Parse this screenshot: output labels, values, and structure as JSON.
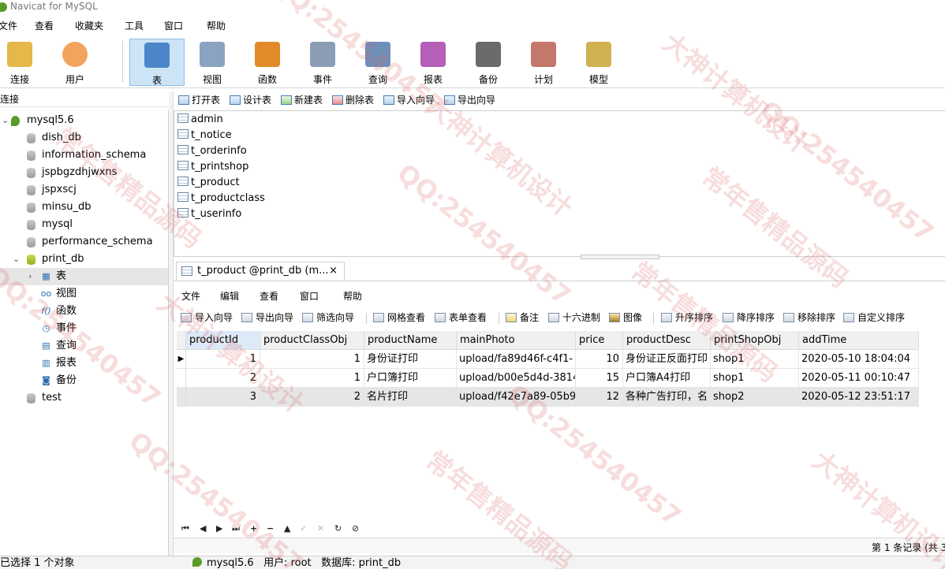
{
  "window": {
    "title": "Navicat for MySQL"
  },
  "menu": [
    "文件",
    "查看",
    "收藏夹",
    "工具",
    "窗口",
    "帮助"
  ],
  "toolbar": {
    "left": [
      {
        "name": "connect",
        "label": "连接",
        "icon": "connect-icon",
        "color": "#e6b84a"
      },
      {
        "name": "user",
        "label": "用户",
        "icon": "user-icon",
        "color": "#f2a35e"
      }
    ],
    "right": [
      {
        "name": "table",
        "label": "表",
        "icon": "table-icon",
        "color": "#4a86c8",
        "active": true
      },
      {
        "name": "view",
        "label": "视图",
        "icon": "view-icon",
        "color": "#8aa3c0"
      },
      {
        "name": "function",
        "label": "函数",
        "icon": "function-icon",
        "color": "#e08a2a"
      },
      {
        "name": "event",
        "label": "事件",
        "icon": "event-icon",
        "color": "#8a9db5"
      },
      {
        "name": "query",
        "label": "查询",
        "icon": "query-icon",
        "color": "#6f8fb8"
      },
      {
        "name": "report",
        "label": "报表",
        "icon": "report-icon",
        "color": "#b55fb8"
      },
      {
        "name": "backup",
        "label": "备份",
        "icon": "backup-icon",
        "color": "#6b6b6b"
      },
      {
        "name": "schedule",
        "label": "计划",
        "icon": "schedule-icon",
        "color": "#c4776b"
      },
      {
        "name": "model",
        "label": "模型",
        "icon": "model-icon",
        "color": "#d0b050"
      }
    ]
  },
  "left_panel": {
    "header": "连接",
    "connection": "mysql5.6",
    "databases": [
      "dish_db",
      "information_schema",
      "jspbgzdhjwxns",
      "jspxscj",
      "minsu_db",
      "mysql",
      "performance_schema"
    ],
    "open_db": "print_db",
    "open_db_children": [
      {
        "label": "表",
        "icon": "table-icon",
        "glyph": "▦",
        "selected": true
      },
      {
        "label": "视图",
        "icon": "view-icon",
        "glyph": "oo"
      },
      {
        "label": "函数",
        "icon": "function-icon",
        "glyph": "f()"
      },
      {
        "label": "事件",
        "icon": "event-icon",
        "glyph": "◷"
      },
      {
        "label": "查询",
        "icon": "query-icon",
        "glyph": "▤"
      },
      {
        "label": "报表",
        "icon": "report-icon",
        "glyph": "▥"
      },
      {
        "label": "备份",
        "icon": "backup-icon",
        "glyph": "◙"
      }
    ],
    "last_db": "test"
  },
  "object_toolbar": [
    "打开表",
    "设计表",
    "新建表",
    "删除表",
    "导入向导",
    "导出向导"
  ],
  "tables": [
    "admin",
    "t_notice",
    "t_orderinfo",
    "t_printshop",
    "t_product",
    "t_productclass",
    "t_userinfo"
  ],
  "tab": {
    "label": "t_product @print_db (m...",
    "close": "×"
  },
  "inner_menu": [
    "文件",
    "编辑",
    "查看",
    "窗口",
    "帮助"
  ],
  "inner_toolbar": [
    "导入向导",
    "导出向导",
    "筛选向导",
    "网格查看",
    "表单查看",
    "备注",
    "十六进制",
    "图像",
    "升序排序",
    "降序排序",
    "移除排序",
    "自定义排序"
  ],
  "grid": {
    "columns": [
      "productId",
      "productClassObj",
      "productName",
      "mainPhoto",
      "price",
      "productDesc",
      "printShopObj",
      "addTime"
    ],
    "rows": [
      [
        "1",
        "1",
        "身份证打印",
        "upload/fa89d46f-c4f1-",
        "10",
        "身份证正反面打印",
        "shop1",
        "2020-05-10 18:04:04"
      ],
      [
        "2",
        "1",
        "户口簿打印",
        "upload/b00e5d4d-3814",
        "15",
        "户口簿A4打印",
        "shop1",
        "2020-05-11 00:10:47"
      ],
      [
        "3",
        "2",
        "名片打印",
        "upload/f42e7a89-05b9",
        "12",
        "各种广告打印，名",
        "shop2",
        "2020-05-12 23:51:17"
      ]
    ]
  },
  "record_nav": [
    "⏮",
    "◀",
    "▶",
    "⏭",
    "+",
    "−",
    "▲",
    "✓",
    "✕",
    "↻",
    "⊘"
  ],
  "record_status": "第 1 条记录 (共 3",
  "status": {
    "selection": "已选择 1 个对象",
    "connection": "mysql5.6",
    "user": "用户: root",
    "database": "数据库: print_db"
  },
  "watermark": [
    "QQ:254540457",
    "常年售精品源码",
    "大神计算机设计"
  ]
}
